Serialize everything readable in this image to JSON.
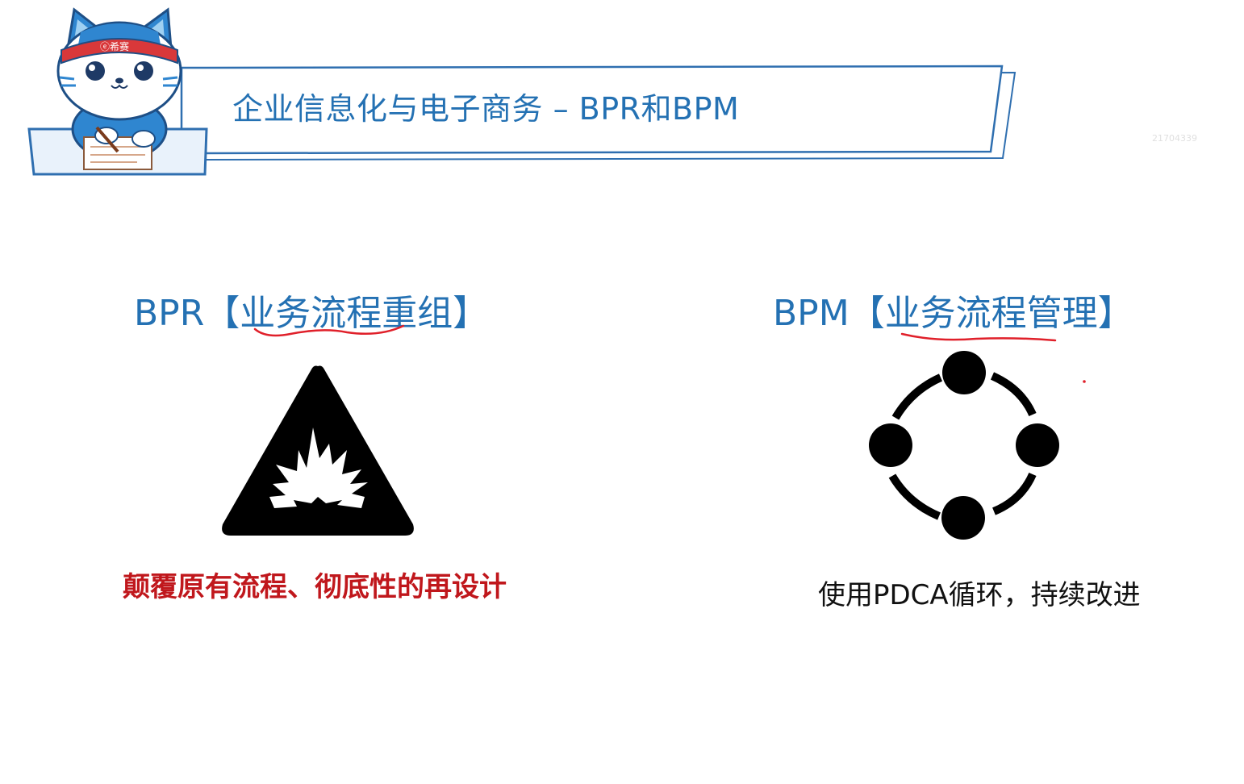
{
  "header": {
    "mascot_badge": "ⓔ希赛",
    "title": "企业信息化与电子商务 – BPR和BPM",
    "watermark": "21704339"
  },
  "bpr": {
    "acronym": "BPR",
    "bracket_open": "【",
    "label": "业务流程重组",
    "bracket_close": "】",
    "icon": "warning-explosion-icon",
    "description": "颠覆原有流程、彻底性的再设计",
    "description_color": "#c0171c"
  },
  "bpm": {
    "acronym": "BPM",
    "bracket_open": "【",
    "label": "业务流程管理",
    "bracket_close": "】",
    "icon": "cycle-four-nodes-icon",
    "description": "使用PDCA循环，持续改进"
  },
  "colors": {
    "accent": "#2471b3",
    "ink_annotation": "#e0202a"
  }
}
